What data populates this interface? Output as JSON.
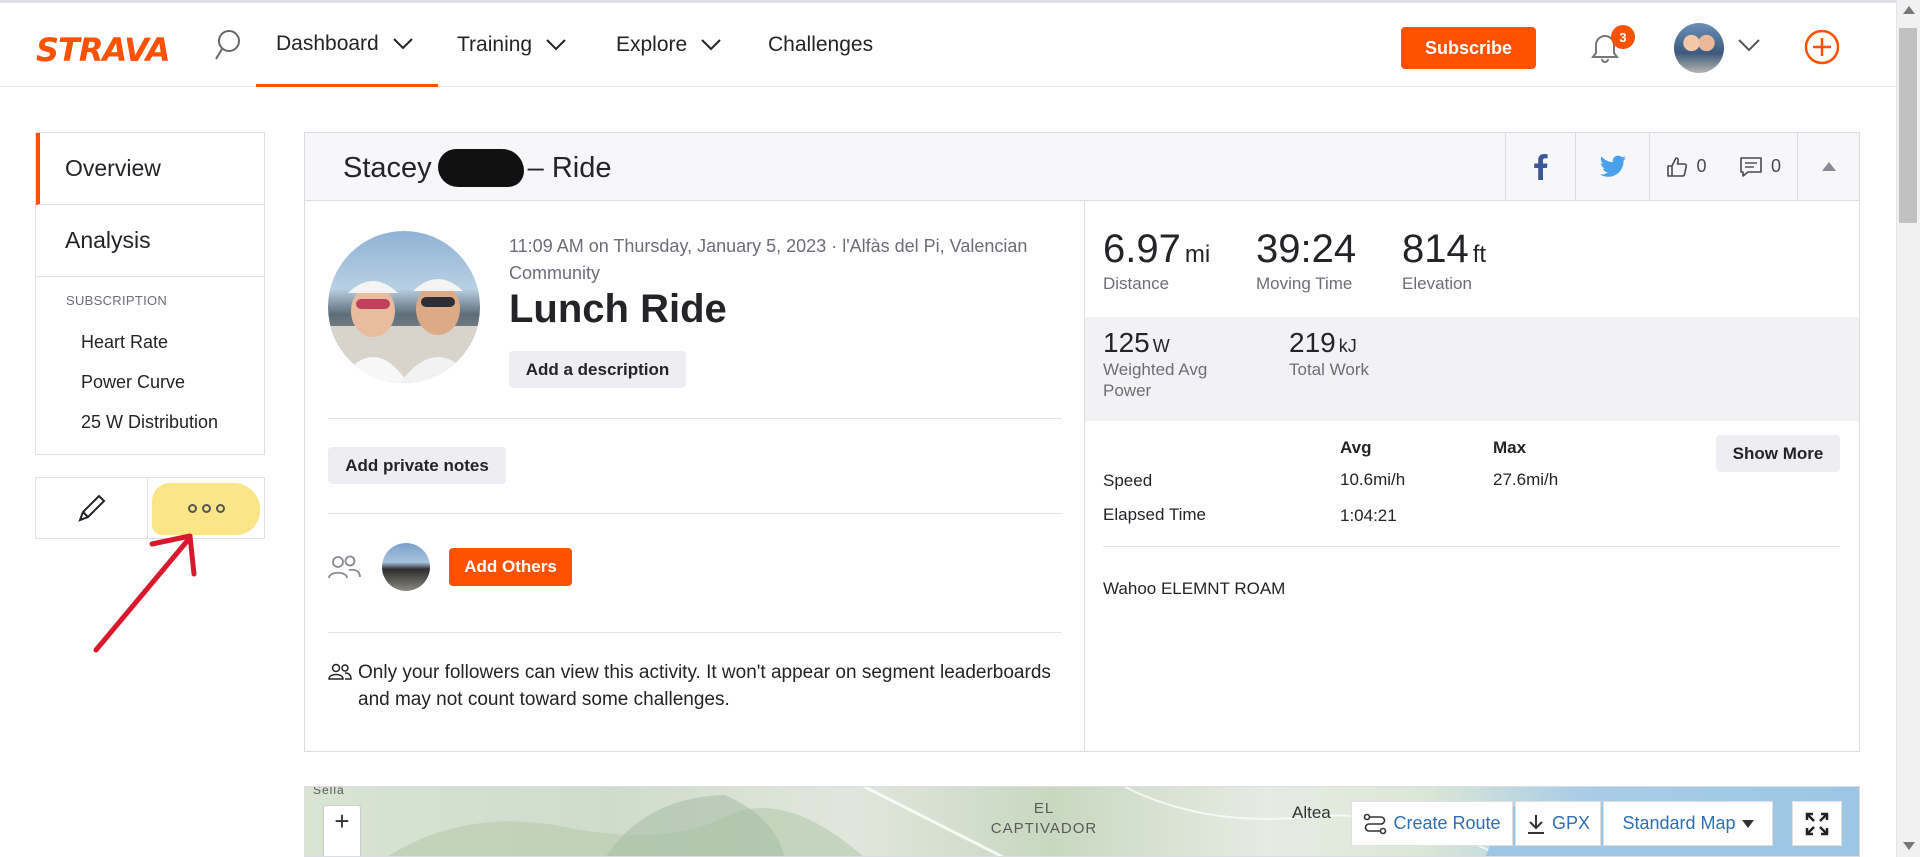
{
  "nav": {
    "logo": "STRAVA",
    "items": [
      {
        "label": "Dashboard"
      },
      {
        "label": "Training"
      },
      {
        "label": "Explore"
      },
      {
        "label": "Challenges"
      }
    ],
    "subscribe": "Subscribe",
    "notification_count": "3",
    "accent_color": "#fc5200"
  },
  "sidebar": {
    "tabs": [
      {
        "label": "Overview"
      },
      {
        "label": "Analysis"
      }
    ],
    "subscription_title": "SUBSCRIPTION",
    "subscription_items": [
      {
        "label": "Heart Rate"
      },
      {
        "label": "Power Curve"
      },
      {
        "label": "25 W Distribution"
      }
    ]
  },
  "activity": {
    "athlete_first": "Stacey",
    "title_suffix": "– Ride",
    "likes": "0",
    "comments": "0",
    "meta": "11:09 AM on Thursday, January 5, 2023 · l'Alfàs del Pi, Valencian Community",
    "name": "Lunch Ride",
    "add_description": "Add a description",
    "add_private_notes": "Add private notes",
    "add_others": "Add Others",
    "privacy_note": "Only your followers can view this activity. It won't appear on segment leaderboards and may not count toward some challenges."
  },
  "stats": {
    "distance": {
      "value": "6.97",
      "unit": "mi",
      "label": "Distance"
    },
    "moving_time": {
      "value": "39:24",
      "label": "Moving Time"
    },
    "elevation": {
      "value": "814",
      "unit": "ft",
      "label": "Elevation"
    },
    "weighted_power": {
      "value": "125",
      "unit": "W",
      "label": "Weighted Avg Power"
    },
    "total_work": {
      "value": "219",
      "unit": "kJ",
      "label": "Total Work"
    },
    "table": {
      "col_avg": "Avg",
      "col_max": "Max",
      "show_more": "Show More",
      "speed_label": "Speed",
      "speed_avg": "10.6mi/h",
      "speed_max": "27.6mi/h",
      "elapsed_label": "Elapsed Time",
      "elapsed_avg": "1:04:21"
    },
    "device": "Wahoo ELEMNT ROAM"
  },
  "map": {
    "zoom_in": "+",
    "place_1": "Sella",
    "place_2": "EL CAPTIVADOR",
    "place_3": "Altea",
    "create_route": "Create Route",
    "gpx": "GPX",
    "map_type": "Standard Map"
  }
}
